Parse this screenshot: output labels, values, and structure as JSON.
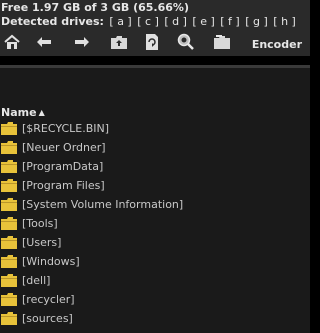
{
  "status": {
    "free_text": "Free 1.97 GB of 3 GB (65.66%)"
  },
  "drives": {
    "label": "Detected drives:",
    "items": [
      "[ a ]",
      "[ c ]",
      "[ d ]",
      "[ e ]",
      "[ f ]",
      "[ g ]",
      "[ h ]"
    ]
  },
  "toolbar": {
    "buttons": [
      "home-icon",
      "back-icon",
      "forward-icon",
      "parent-folder-icon",
      "refresh-icon",
      "search-icon",
      "new-folder-icon"
    ],
    "encoder_label": "Encoder"
  },
  "list": {
    "header": "Name",
    "sort": "ascending",
    "items": [
      "[$RECYCLE.BIN]",
      "[Neuer Ordner]",
      "[ProgramData]",
      "[Program Files]",
      "[System Volume Information]",
      "[Tools]",
      "[Users]",
      "[Windows]",
      "[dell]",
      "[recycler]",
      "[sources]"
    ]
  },
  "colors": {
    "folder": "#e8c23a",
    "background": "#1a1a1a",
    "text": "#c8c8c8"
  }
}
